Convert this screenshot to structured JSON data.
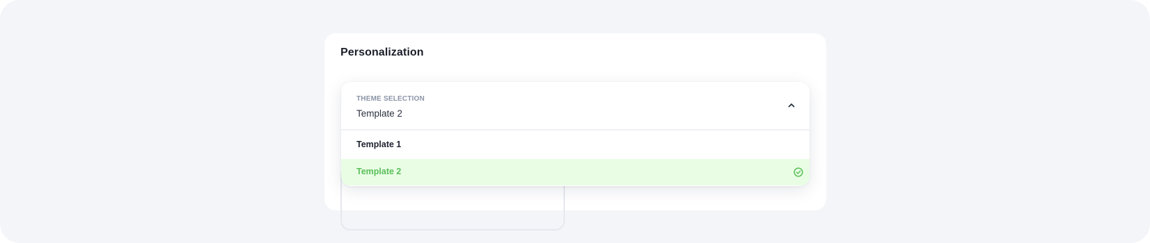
{
  "card": {
    "title": "Personalization"
  },
  "theme_select": {
    "label": "THEME SELECTION",
    "selected_value": "Template 2",
    "expanded": true,
    "chevron_icon": "chevron-up-icon",
    "options": [
      {
        "label": "Template 1",
        "selected": false
      },
      {
        "label": "Template 2",
        "selected": true,
        "indicator_icon": "check-circle-icon"
      }
    ]
  },
  "colors": {
    "page_background": "#f4f5f8",
    "card_background": "#ffffff",
    "selected_option_background": "#e9fde5",
    "selected_option_text": "#5bbf5a",
    "label_text": "#8a93a6",
    "title_text": "#1b1f2a"
  }
}
